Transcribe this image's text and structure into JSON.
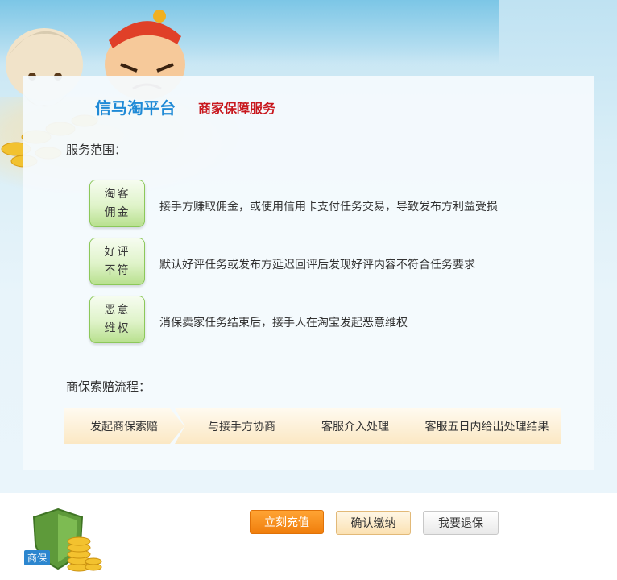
{
  "header": {
    "brand": "信马淘平台",
    "subtitle": "商家保障服务"
  },
  "scope": {
    "label": "服务范围：",
    "items": [
      {
        "badge_line1": "淘客",
        "badge_line2": "佣金",
        "description": "接手方赚取佣金，或使用信用卡支付任务交易，导致发布方利益受损"
      },
      {
        "badge_line1": "好评",
        "badge_line2": "不符",
        "description": "默认好评任务或发布方延迟回评后发现好评内容不符合任务要求"
      },
      {
        "badge_line1": "恶意",
        "badge_line2": "维权",
        "description": "消保卖家任务结束后，接手人在淘宝发起恶意维权"
      }
    ]
  },
  "process": {
    "label": "商保索赔流程：",
    "steps": [
      "发起商保索赔",
      "与接手方协商",
      "客服介入处理",
      "客服五日内给出处理结果"
    ]
  },
  "actions": {
    "charge": "立刻充值",
    "confirm": "确认缴纳",
    "refund": "我要退保"
  },
  "logo": {
    "label": "商保",
    "icon": "shield-coins-icon"
  },
  "colors": {
    "brand": "#1f8ad6",
    "subtitle": "#c8181e",
    "charge_button": "#f07e0c",
    "badge_green": "#b8e08e"
  }
}
